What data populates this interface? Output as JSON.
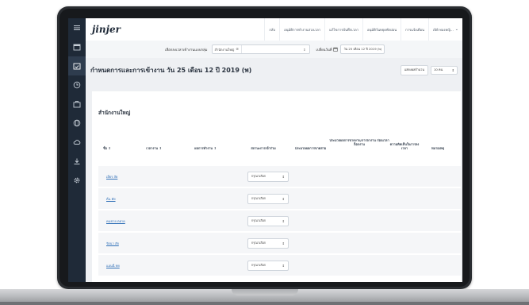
{
  "app": {
    "logo": "jinjer"
  },
  "sidebar": {
    "items": [
      {
        "icon": "menu-icon"
      },
      {
        "icon": "calendar-icon"
      },
      {
        "icon": "calendar-check-icon"
      },
      {
        "icon": "clock-icon"
      },
      {
        "icon": "briefcase-icon"
      },
      {
        "icon": "globe-icon"
      },
      {
        "icon": "cloud-icon"
      },
      {
        "icon": "download-icon"
      },
      {
        "icon": "gear-icon"
      }
    ]
  },
  "nav": {
    "items": [
      {
        "label": "กลับ"
      },
      {
        "label": "อนุมัติการทำงานล่วงเวลา"
      },
      {
        "label": "แก้ไขการบันทึกเวลา"
      },
      {
        "label": "อนุมัติวันหยุดพักผ่อน"
      },
      {
        "label": "การแจ้งเตือน"
      },
      {
        "label": "เปิดิ ทองหญิ..."
      }
    ]
  },
  "filter": {
    "group_label": "เลือกลงเวลาเข้างานแบบกลุ่ม",
    "chip": "สำนักงานใหญ่",
    "date_label": "เปลี่ยนวันที่",
    "date_value": "วัน 25 เดือน 12 ปี 2019 (พ)"
  },
  "title": {
    "text": "กำหนดการและการเข้างาน วัน 25 เดือน 12 ปี 2019 (พ)",
    "display_button": "แสดงผลจำนวน",
    "count_value": "10 คน"
  },
  "card": {
    "title": "สำนักงานใหญ่",
    "headers": [
      "ชื่อ ↕",
      "เวลางาน ↕",
      "ผลการทำงาน ↕",
      "สถานะการเข้าร่วม",
      "ประมวลผลการขาดสาย",
      "ประมวลผลการขาดงาน/การลางาน ก่อนเวลา ล็อกงาน",
      "ความคิดเห็นในการลงเวลา",
      "หมายเหตุ"
    ],
    "rows": [
      {
        "name": "เอียร สัย",
        "status": "กรุณาเลือก"
      },
      {
        "name": "ต้น ตัย",
        "status": "กรุณาเลือก"
      },
      {
        "name": "คนชาย ตยาด",
        "status": "กรุณาเลือก"
      },
      {
        "name": "รัตนา สัย",
        "status": "กรุณาเลือก"
      },
      {
        "name": "แอนนี่ ทย",
        "status": "กรุณาเลือก"
      }
    ]
  }
}
